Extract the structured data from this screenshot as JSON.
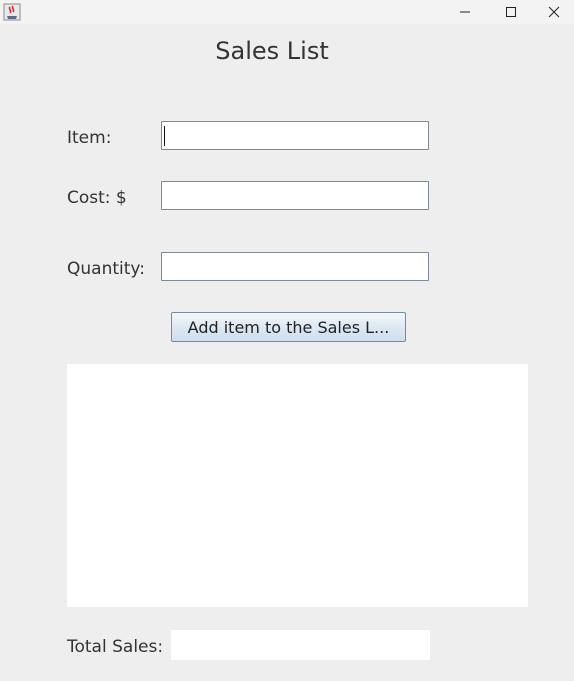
{
  "window": {
    "title": ""
  },
  "form": {
    "heading": "Sales List",
    "item_label": "Item:",
    "item_value": "",
    "cost_label": "Cost: $",
    "cost_value": "",
    "quantity_label": "Quantity:",
    "quantity_value": "",
    "add_button_label": "Add item to the Sales L...",
    "sales_list_items": [],
    "total_label": "Total Sales:",
    "total_value": ""
  },
  "icons": {
    "app": "java-coffee-icon",
    "minimize": "minimize-icon",
    "maximize": "maximize-icon",
    "close": "close-icon"
  }
}
